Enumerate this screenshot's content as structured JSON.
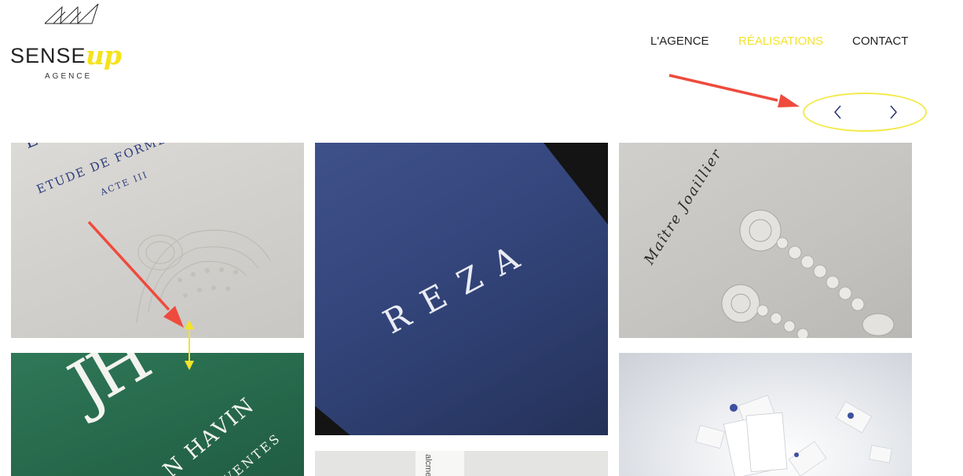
{
  "logo": {
    "word": "SENSE",
    "accent": "up",
    "tagline": "AGENCE",
    "brand_color": "#f5e31a"
  },
  "nav": {
    "items": [
      {
        "label": "L'AGENCE",
        "active": false
      },
      {
        "label": "RÉALISATIONS",
        "active": true
      },
      {
        "label": "CONTACT",
        "active": false
      }
    ],
    "active_color": "#f2e32a"
  },
  "pager": {
    "prev_icon": "chevron-left-icon",
    "next_icon": "chevron-right-icon",
    "highlight_color": "#f4ea4a"
  },
  "gallery": {
    "tiles": [
      {
        "name": "etude-de-formes",
        "line1": "ETUDE DE FORMES",
        "line2": "ACTE III",
        "corner": "E"
      },
      {
        "name": "reza",
        "title": "REZA"
      },
      {
        "name": "maitre-joaillier",
        "title": "Maître Joaillier"
      },
      {
        "name": "havin",
        "monogram": "JH",
        "text1": "N HAVIN",
        "text2": "E VENTES"
      },
      {
        "name": "alcme",
        "text": "alcme"
      },
      {
        "name": "business-cards"
      }
    ]
  },
  "annotations": {
    "arrow_color": "#ee4b3d",
    "marker_color": "#f2e32a"
  }
}
